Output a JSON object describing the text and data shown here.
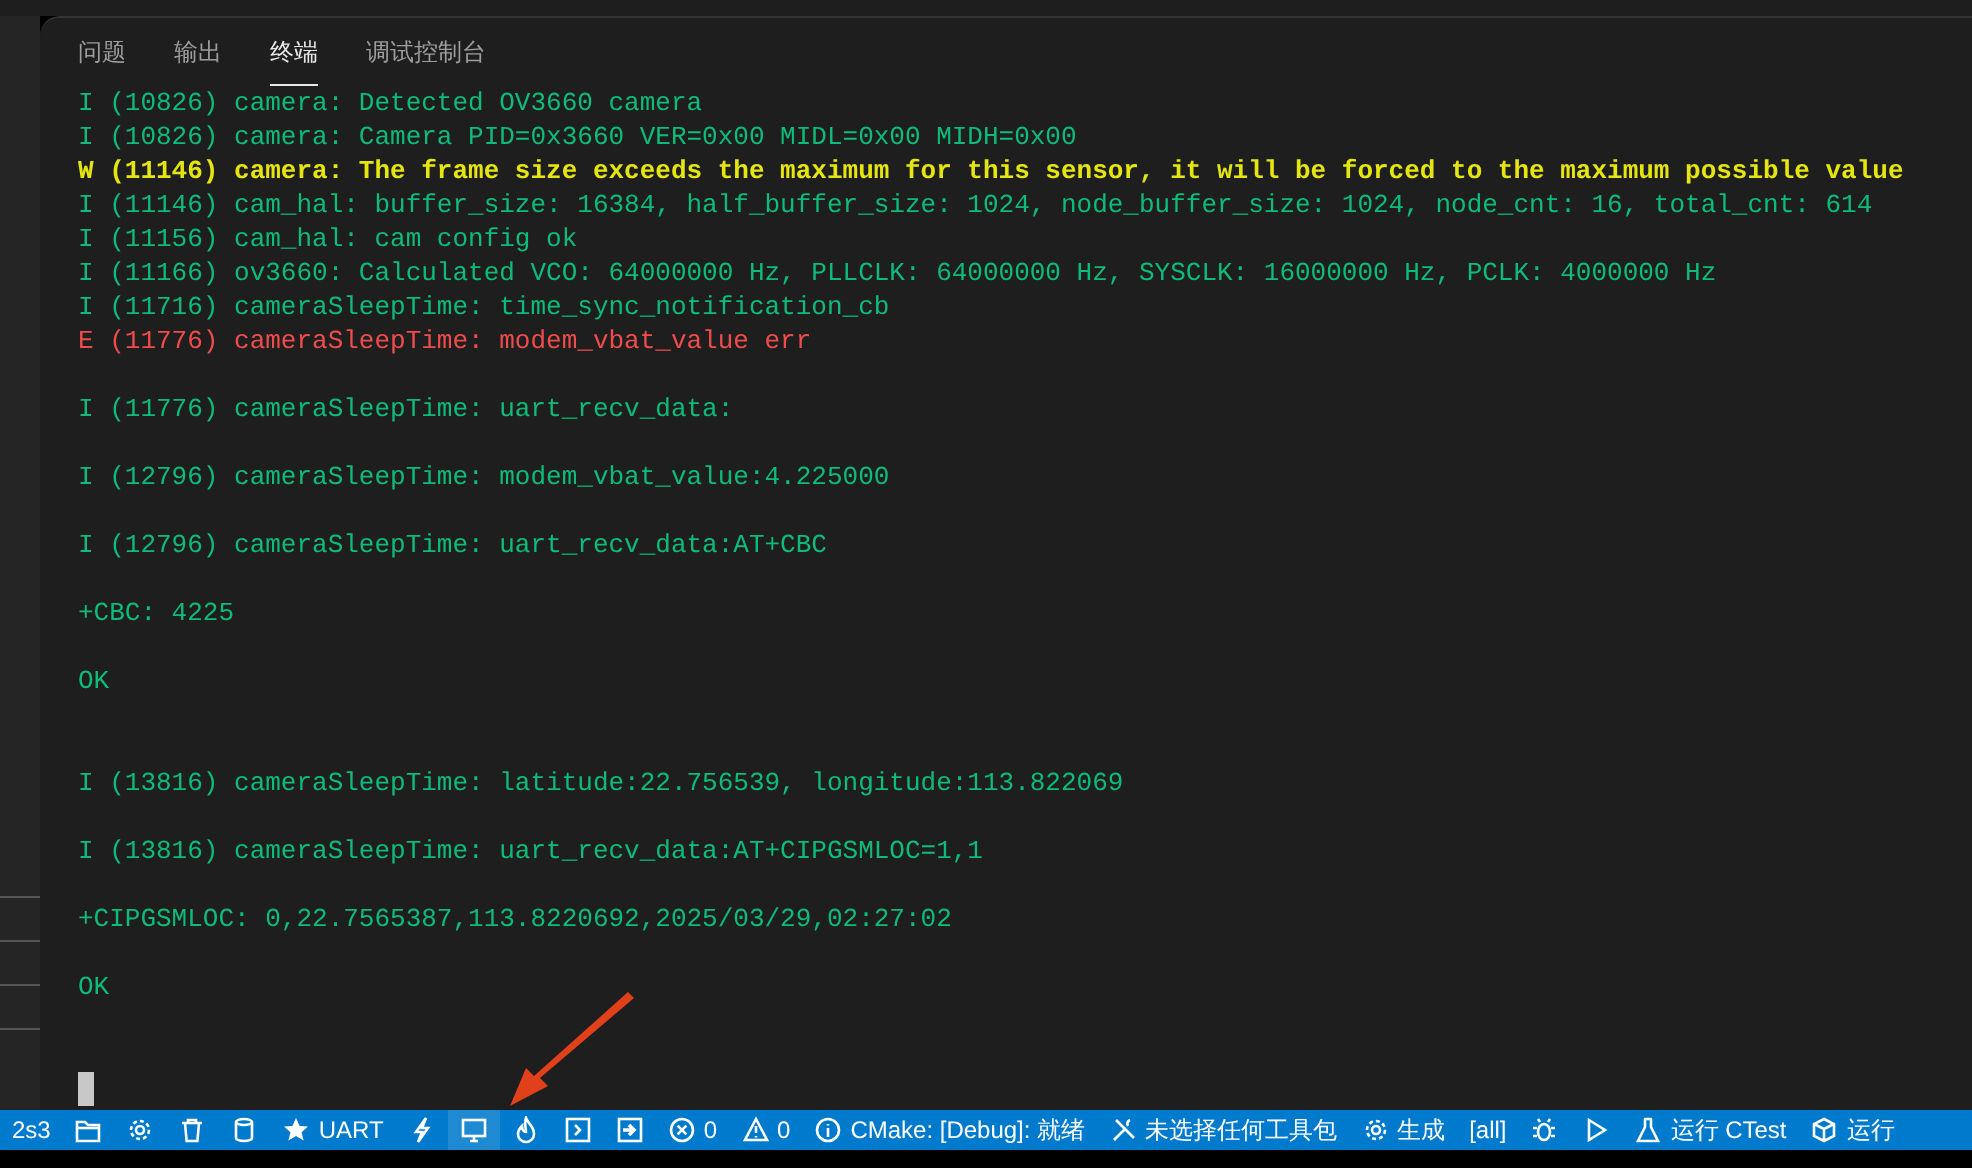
{
  "panel_tabs": [
    {
      "label": "问题",
      "selected": false
    },
    {
      "label": "输出",
      "selected": false
    },
    {
      "label": "终端",
      "selected": true
    },
    {
      "label": "调试控制台",
      "selected": false
    }
  ],
  "terminal_lines": [
    {
      "kind": "info",
      "text": "I (10826) camera: Detected OV3660 camera"
    },
    {
      "kind": "info",
      "text": "I (10826) camera: Camera PID=0x3660 VER=0x00 MIDL=0x00 MIDH=0x00"
    },
    {
      "kind": "warning",
      "text": "W (11146) camera: The frame size exceeds the maximum for this sensor, it will be forced to the maximum possible value"
    },
    {
      "kind": "info",
      "text": "I (11146) cam_hal: buffer_size: 16384, half_buffer_size: 1024, node_buffer_size: 1024, node_cnt: 16, total_cnt: 614"
    },
    {
      "kind": "info",
      "text": "I (11156) cam_hal: cam config ok"
    },
    {
      "kind": "info",
      "text": "I (11166) ov3660: Calculated VCO: 64000000 Hz, PLLCLK: 64000000 Hz, SYSCLK: 16000000 Hz, PCLK: 4000000 Hz"
    },
    {
      "kind": "info",
      "text": "I (11716) cameraSleepTime: time_sync_notification_cb"
    },
    {
      "kind": "error",
      "text": "E (11776) cameraSleepTime: modem_vbat_value err"
    },
    {
      "kind": "blank"
    },
    {
      "kind": "info",
      "text": "I (11776) cameraSleepTime: uart_recv_data:"
    },
    {
      "kind": "blank"
    },
    {
      "kind": "info",
      "text": "I (12796) cameraSleepTime: modem_vbat_value:4.225000"
    },
    {
      "kind": "blank"
    },
    {
      "kind": "info",
      "text": "I (12796) cameraSleepTime: uart_recv_data:AT+CBC"
    },
    {
      "kind": "blank"
    },
    {
      "kind": "info",
      "text": "+CBC: 4225"
    },
    {
      "kind": "blank"
    },
    {
      "kind": "info",
      "text": "OK"
    },
    {
      "kind": "blank"
    },
    {
      "kind": "blank"
    },
    {
      "kind": "info",
      "text": "I (13816) cameraSleepTime: latitude:22.756539, longitude:113.822069"
    },
    {
      "kind": "blank"
    },
    {
      "kind": "info",
      "text": "I (13816) cameraSleepTime: uart_recv_data:AT+CIPGSMLOC=1,1"
    },
    {
      "kind": "blank"
    },
    {
      "kind": "info",
      "text": "+CIPGSMLOC: 0,22.7565387,113.8220692,2025/03/29,02:27:02"
    },
    {
      "kind": "blank"
    },
    {
      "kind": "info",
      "text": "OK"
    },
    {
      "kind": "blank"
    },
    {
      "kind": "blank"
    },
    {
      "kind": "cursor"
    }
  ],
  "status_bar": [
    {
      "label": "2s3",
      "hovered": false
    },
    {
      "hovered": false
    },
    {
      "hovered": false
    },
    {
      "hovered": false
    },
    {
      "hovered": false
    },
    {
      "label": "UART",
      "hovered": false
    },
    {
      "hovered": false
    },
    {
      "hovered": true
    },
    {
      "hovered": false
    },
    {
      "hovered": false
    },
    {
      "hovered": false
    },
    {
      "label": "0",
      "hovered": false
    },
    {
      "label": "0",
      "hovered": false
    },
    {
      "label": "CMake: [Debug]: 就绪",
      "hovered": false
    },
    {
      "label": "未选择任何工具包",
      "hovered": false
    },
    {
      "label": "生成",
      "hovered": false
    },
    {
      "label": "[all]",
      "hovered": false
    },
    {
      "hovered": false
    },
    {
      "hovered": false
    },
    {
      "label": "运行 CTest",
      "hovered": false
    },
    {
      "label": "运行",
      "hovered": false
    }
  ]
}
